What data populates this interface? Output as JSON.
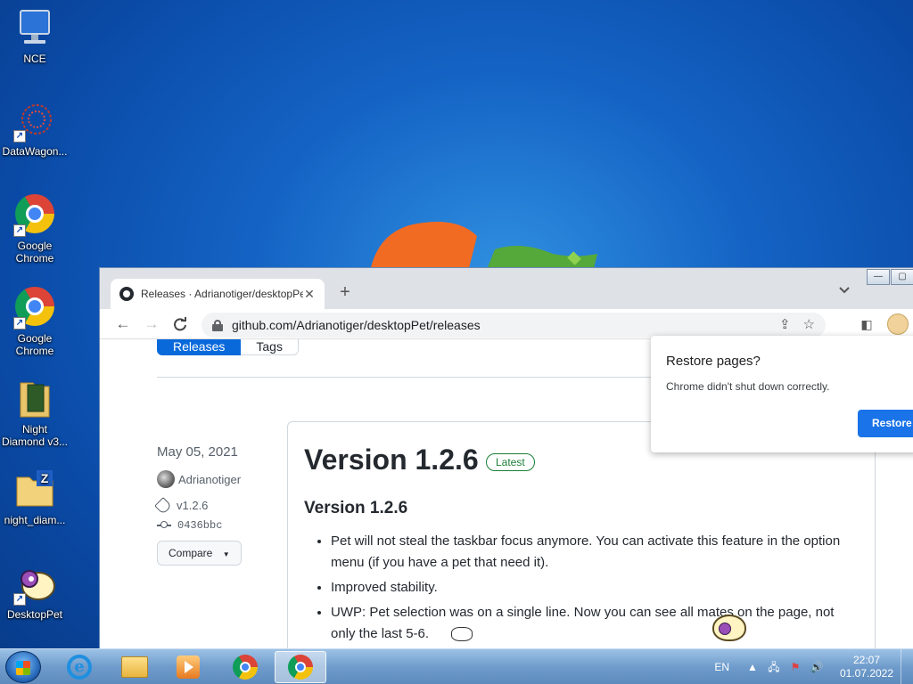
{
  "desktop": {
    "icons": [
      {
        "label": "NCE",
        "icon": "computer-icon"
      },
      {
        "label": "DataWagon...",
        "icon": "datawagon-icon"
      },
      {
        "label": "Google Chrome",
        "icon": "chrome-icon"
      },
      {
        "label": "Google Chrome",
        "icon": "chrome-icon"
      },
      {
        "label": "Night Diamond v3...",
        "icon": "folder-icon"
      },
      {
        "label": "night_diam...",
        "icon": "zip-folder-icon"
      },
      {
        "label": "DesktopPet",
        "icon": "sheep-icon"
      }
    ]
  },
  "window": {
    "tab_title": "Releases · Adrianotiger/desktopPet",
    "tab_close": "✕",
    "new_tab": "+",
    "tab_dropdown": "⌄",
    "controls": {
      "minimize": "—",
      "maximize": "▢"
    },
    "url": "github.com/Adrianotiger/desktopPet/releases"
  },
  "page": {
    "subnav": {
      "releases": "Releases",
      "tags": "Tags"
    },
    "release": {
      "date": "May 05, 2021",
      "author": "Adrianotiger",
      "tag": "v1.2.6",
      "commit": "0436bbc",
      "compare_label": "Compare",
      "title": "Version 1.2.6",
      "badge": "Latest",
      "subtitle": "Version 1.2.6",
      "notes": [
        "Pet will not steal the taskbar focus anymore. You can activate this feature in the option menu (if you have a pet that need it).",
        "Improved stability.",
        "UWP: Pet selection was on a single line. Now you can see all mates on the page, not only the last 5-6."
      ]
    }
  },
  "popup": {
    "title": "Restore pages?",
    "message": "Chrome didn't shut down correctly.",
    "button": "Restore"
  },
  "taskbar": {
    "items": [
      "internet-explorer-icon",
      "windows-explorer-icon",
      "media-center-icon",
      "chrome-icon",
      "chrome-icon-active"
    ],
    "language": "EN",
    "time": "22:07",
    "date": "01.07.2022"
  },
  "colors": {
    "accent": "#0969da",
    "chrome_button": "#1a73e8",
    "latest_badge": "#1a7f37"
  }
}
